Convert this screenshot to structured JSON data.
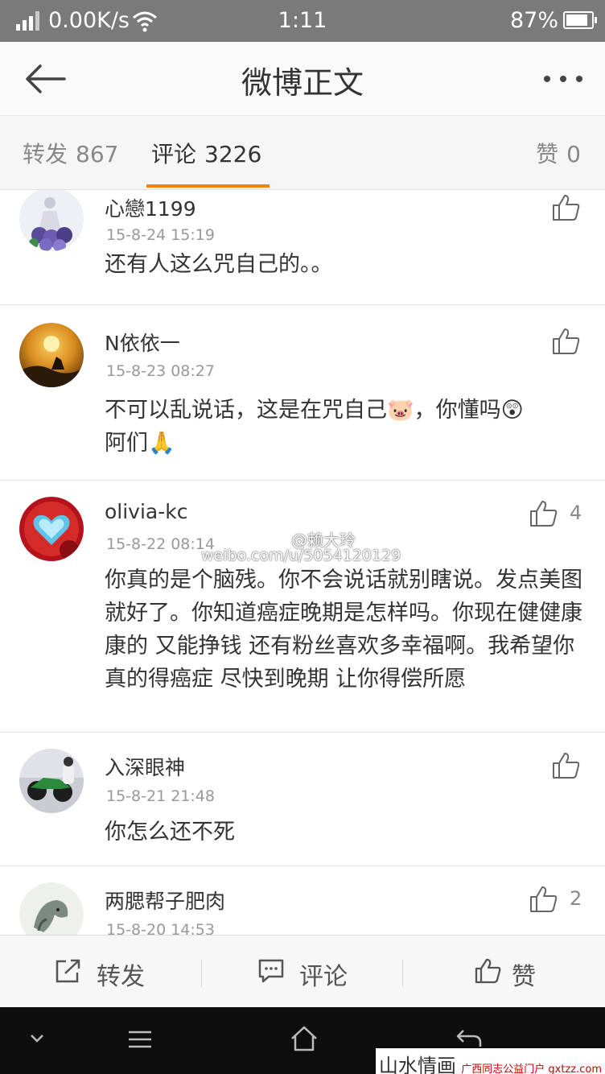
{
  "status_bar": {
    "network_speed": "0.00K/s",
    "time": "1:11",
    "battery_percent": "87%",
    "battery_level": 0.87
  },
  "nav": {
    "title": "微博正文"
  },
  "tabs": {
    "repost_label": "转发",
    "repost_count": "867",
    "comment_label": "评论",
    "comment_count": "3226",
    "like_label": "赞",
    "like_count": "0"
  },
  "comments": [
    {
      "name": "心戀1199",
      "time": "15-8-24 15:19",
      "text": "还有人这么咒自己的。。",
      "likes": ""
    },
    {
      "name": "N依依一",
      "time": "15-8-23 08:27",
      "text": "不可以乱说话，这是在咒自己🐷，你懂吗😲阿们🙏",
      "likes": ""
    },
    {
      "name": "olivia-kc",
      "time": "15-8-22 08:14",
      "text": "你真的是个脑残。你不会说话就别瞎说。发点美图就好了。你知道癌症晚期是怎样吗。你现在健健康康的 又能挣钱 还有粉丝喜欢多幸福啊。我希望你真的得癌症 尽快到晚期 让你得偿所愿",
      "likes": "4"
    },
    {
      "name": "入深眼神",
      "time": "15-8-21 21:48",
      "text": "你怎么还不死",
      "likes": ""
    },
    {
      "name": "两腮帮子肥肉",
      "time": "15-8-20 14:53",
      "text": "",
      "likes": "2"
    }
  ],
  "watermark": {
    "user": "@赖大玲",
    "url": "weibo.com/u/5054120129"
  },
  "bottom_bar": {
    "repost": "转发",
    "comment": "评论",
    "like": "赞"
  },
  "site_logo": {
    "main": "山水情画",
    "sub": "广西同志公益门户 gxtzz.com"
  },
  "icons": {
    "back": "back-arrow-icon",
    "more": "more-dots-icon",
    "like": "thumbs-up-icon",
    "repost": "repost-icon",
    "comment": "comment-bubble-icon"
  },
  "colors": {
    "accent": "#ff8200",
    "status_bar": "#7a7a7a",
    "nav_background": "#fafafa",
    "system_nav": "#0d0d0d"
  }
}
